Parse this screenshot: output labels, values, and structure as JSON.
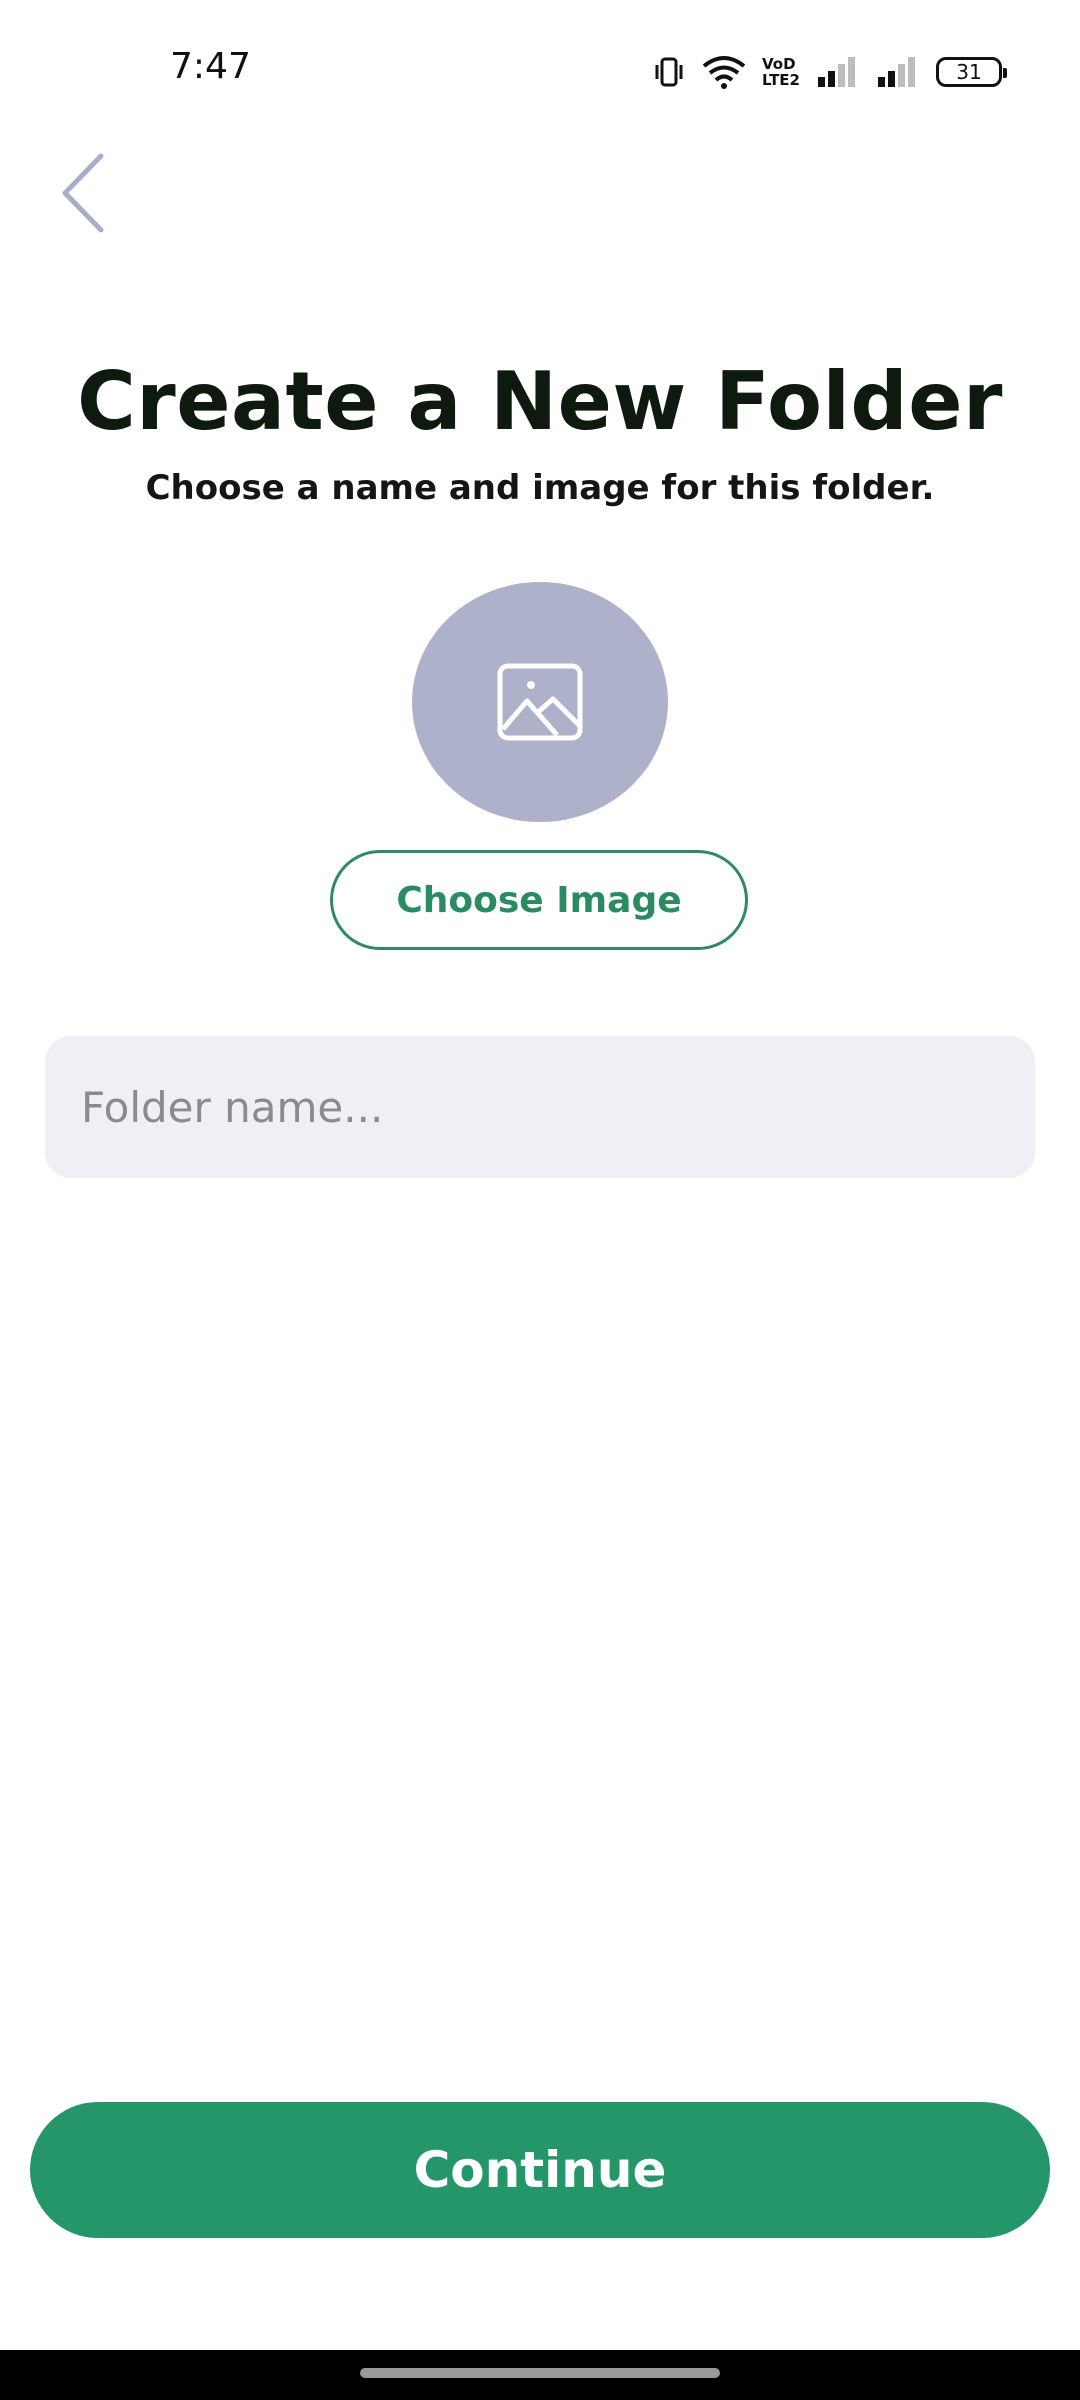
{
  "status_bar": {
    "time": "7:47",
    "battery_level": "31",
    "icons": [
      "vibrate-icon",
      "wifi-icon",
      "volte-icon",
      "signal-icon",
      "signal-icon",
      "battery-icon"
    ],
    "volte_line1": "VoD",
    "volte_line2": "LTE2"
  },
  "header": {
    "back_icon": "chevron-left-icon"
  },
  "main": {
    "title": "Create a New Folder",
    "subtitle": "Choose a name and image for this folder.",
    "image_placeholder_icon": "image-icon",
    "choose_image_label": "Choose Image",
    "folder_name_placeholder": "Folder name...",
    "folder_name_value": ""
  },
  "footer": {
    "continue_label": "Continue"
  },
  "colors": {
    "accent": "#24966a",
    "accent_text": "#2a8a62",
    "placeholder_circle": "#adb2ca",
    "input_background": "#efeff5",
    "back_chevron": "#a9aec7"
  }
}
